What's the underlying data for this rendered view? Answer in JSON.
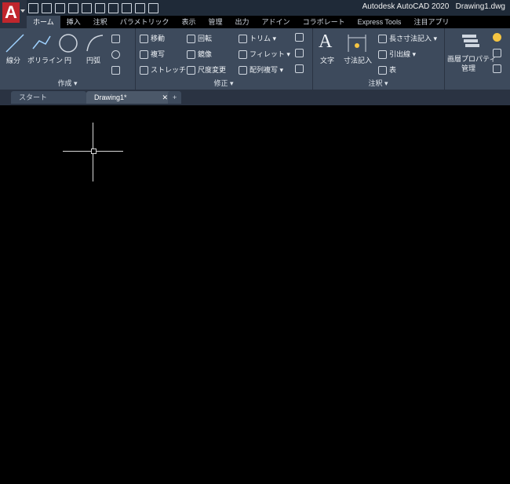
{
  "window": {
    "app_title": "Autodesk AutoCAD 2020",
    "document_title": "Drawing1.dwg"
  },
  "app_menu": {
    "logo_text": "A"
  },
  "ribbon_tabs": [
    {
      "label": "ホーム"
    },
    {
      "label": "挿入"
    },
    {
      "label": "注釈"
    },
    {
      "label": "パラメトリック"
    },
    {
      "label": "表示"
    },
    {
      "label": "管理"
    },
    {
      "label": "出力"
    },
    {
      "label": "アドイン"
    },
    {
      "label": "コラボレート"
    },
    {
      "label": "Express Tools"
    },
    {
      "label": "注目アプリ"
    }
  ],
  "panels": {
    "draw": {
      "label": "作成 ▾",
      "tools": [
        "線分",
        "ポリライン",
        "円",
        "円弧"
      ]
    },
    "modify": {
      "label": "修正 ▾",
      "tools": [
        "移動",
        "回転",
        "トリム ▾",
        "複写",
        "鏡像",
        "フィレット ▾",
        "ストレッチ",
        "尺度変更",
        "配列複写 ▾"
      ]
    },
    "annotation": {
      "label": "注釈 ▾",
      "tools": [
        "文字",
        "寸法記入",
        "長さ寸法記入 ▾",
        "引出線 ▾",
        "表"
      ]
    },
    "layers": {
      "tools": [
        "画層プロパティ",
        "管理"
      ]
    }
  },
  "file_tabs": [
    {
      "label": "スタート"
    },
    {
      "label": "Drawing1*"
    }
  ],
  "file_tab_close": "✕",
  "new_tab": "+"
}
